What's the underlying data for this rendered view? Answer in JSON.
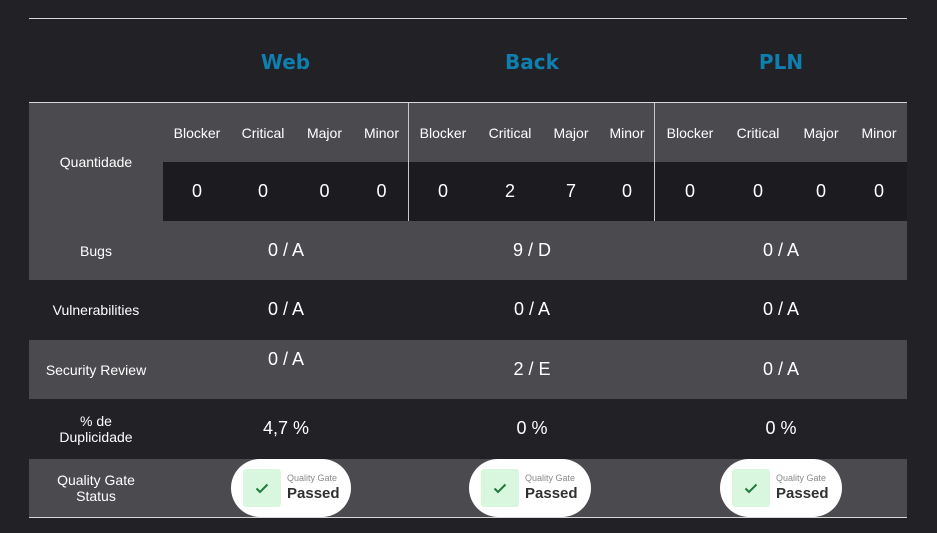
{
  "projects": [
    "Web",
    "Back",
    "PLN"
  ],
  "severities": [
    "Blocker",
    "Critical",
    "Major",
    "Minor"
  ],
  "row_labels": {
    "quantidade": "Quantidade",
    "bugs": "Bugs",
    "vulnerabilities": "Vulnerabilities",
    "security_review": "Security Review",
    "duplicidade_1": "% de",
    "duplicidade_2": "Duplicidade",
    "quality_gate_1": "Quality Gate",
    "quality_gate_2": "Status"
  },
  "quantidade": [
    [
      "0",
      "0",
      "0",
      "0"
    ],
    [
      "0",
      "2",
      "7",
      "0"
    ],
    [
      "0",
      "0",
      "0",
      "0"
    ]
  ],
  "bugs": [
    "0 / A",
    "9 / D",
    "0 / A"
  ],
  "vulnerabilities": [
    "0 / A",
    "0 / A",
    "0 / A"
  ],
  "security_review": [
    "0 / A",
    "2 / E",
    "0 / A"
  ],
  "duplicidade": [
    "4,7 %",
    "0 %",
    "0 %"
  ],
  "quality_gate": {
    "label": "Quality Gate",
    "status": [
      "Passed",
      "Passed",
      "Passed"
    ],
    "icon": "check-icon"
  },
  "colors": {
    "title": "#0f7fb0",
    "band_light": "#4b4a4f",
    "band_dark": "#222126",
    "passed_bg": "#d8f7de",
    "check": "#1f7a3a"
  }
}
